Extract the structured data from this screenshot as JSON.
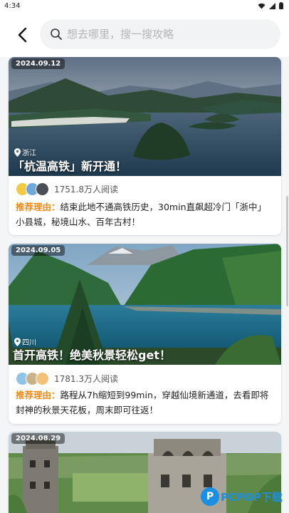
{
  "status_bar": {
    "time": "4:34"
  },
  "search": {
    "placeholder": "想去哪里，搜一搜攻略"
  },
  "cards": [
    {
      "date": "2024.09.12",
      "location": "浙江",
      "title": "「杭温高铁」新开通！",
      "reads": "1751.8万人阅读",
      "reason_label": "推荐理由：",
      "reason_text": "结束此地不通高铁历史，30min直飙超冷门「浙中」小县城，秘境山水、百年古村！"
    },
    {
      "date": "2024.09.05",
      "location": "四川",
      "title": "首开高铁！绝美秋景轻松get！",
      "reads": "1781.3万人阅读",
      "reason_label": "推荐理由：",
      "reason_text": "路程从7h缩短到99min，穿越仙境新通道，去看即将封神的秋景天花板，周末即可往返！"
    },
    {
      "date": "2024.08.29"
    }
  ],
  "watermark": {
    "logo_letter": "P",
    "text": "PCPOP下载"
  },
  "colors": {
    "accent": "#f08a17",
    "background": "#f4f5f7"
  },
  "icons": [
    "back-arrow-icon",
    "search-icon",
    "location-pin-icon",
    "wifi-icon",
    "signal-icon",
    "battery-icon"
  ]
}
